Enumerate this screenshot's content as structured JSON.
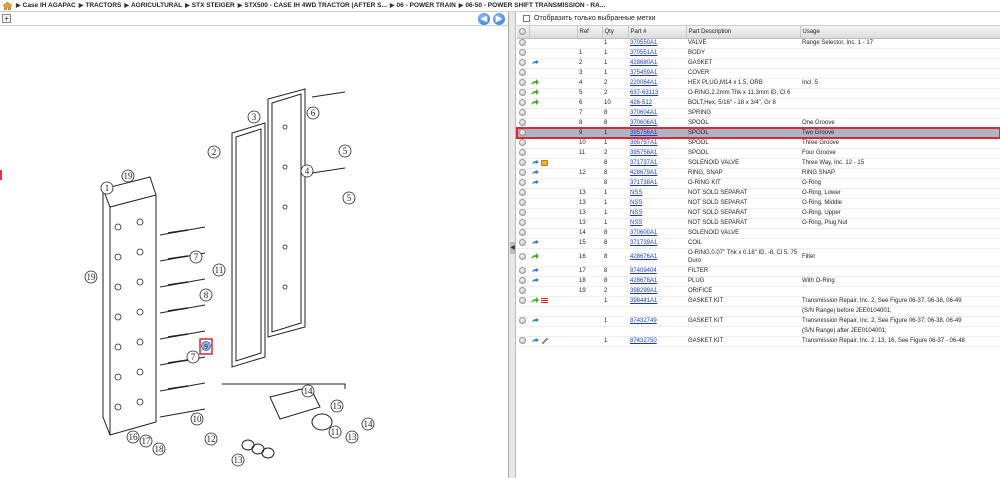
{
  "breadcrumb": [
    "Case IH AGAPAC",
    "TRACTORS",
    "AGRICULTURAL",
    "STX STEIGER",
    "STX500 - CASE IH 4WD TRACTOR (AFTER S...",
    "06 - POWER TRAIN",
    "06-50 - POWER SHIFT TRANSMISSION - RA..."
  ],
  "left_toolbar": {
    "plus": "+",
    "minus": "-",
    "back": "◀",
    "forward": "▶"
  },
  "filter": {
    "label": "Отобразить только выбранные метки"
  },
  "table": {
    "headers": {
      "ref": "Ref",
      "qty": "Qty",
      "part": "Part #",
      "desc": "Part Description",
      "usage": "Usage"
    },
    "rows": [
      {
        "ref": "",
        "qty": "1",
        "part": "370550A1",
        "desc": "VALVE",
        "usage": "Range Selector, Inc. 1 - 17",
        "icons": []
      },
      {
        "ref": "1",
        "qty": "1",
        "part": "370551A1",
        "desc": "BODY",
        "usage": "",
        "icons": []
      },
      {
        "ref": "2",
        "qty": "1",
        "part": "428680A1",
        "desc": "GASKET",
        "usage": "",
        "icons": [
          "blue"
        ]
      },
      {
        "ref": "3",
        "qty": "1",
        "part": "375459A1",
        "desc": "COVER",
        "usage": "",
        "icons": []
      },
      {
        "ref": "4",
        "qty": "2",
        "part": "220064A1",
        "desc": "HEX PLUG,M14 x 1.5, ORB",
        "usage": "Incl. 5",
        "icons": [
          "green"
        ]
      },
      {
        "ref": "5",
        "qty": "2",
        "part": "637-63113",
        "desc": "O-RING,2.2mm Thk x 11.3mm ID, Cl 6",
        "usage": "",
        "icons": [
          "green"
        ]
      },
      {
        "ref": "6",
        "qty": "10",
        "part": "426-512",
        "desc": "BOLT,Hex, 5/16\" - 18 x 3/4\", Gr 8",
        "usage": "",
        "icons": [
          "green"
        ]
      },
      {
        "ref": "7",
        "qty": "8",
        "part": "370604A1",
        "desc": "SPRING",
        "usage": "",
        "icons": []
      },
      {
        "ref": "8",
        "qty": "8",
        "part": "370606A1",
        "desc": "SPOOL",
        "usage": "One Groove",
        "icons": []
      },
      {
        "ref": "9",
        "qty": "1",
        "part": "395756A1",
        "desc": "SPOOL",
        "usage": "Two Groove",
        "icons": [],
        "selected": true
      },
      {
        "ref": "10",
        "qty": "1",
        "part": "395757A1",
        "desc": "SPOOL",
        "usage": "Three Groove",
        "icons": []
      },
      {
        "ref": "11",
        "qty": "2",
        "part": "395758A1",
        "desc": "SPOOL",
        "usage": "Four Groove",
        "icons": []
      },
      {
        "ref": "",
        "qty": "8",
        "part": "371737A1",
        "desc": "SOLENOID VALVE",
        "usage": "Three Way, Inc. 12 - 15",
        "icons": [
          "blue",
          "orange"
        ]
      },
      {
        "ref": "12",
        "qty": "8",
        "part": "428679A1",
        "desc": "RING, SNAP",
        "usage": "RING SNAP",
        "icons": [
          "blue"
        ]
      },
      {
        "ref": "",
        "qty": "8",
        "part": "371738A1",
        "desc": "O-RING KIT",
        "usage": "O-Ring",
        "icons": [
          "blue"
        ]
      },
      {
        "ref": "13",
        "qty": "1",
        "part": "NSS",
        "desc": "NOT SOLD SEPARAT",
        "usage": "O-Ring, Lower",
        "icons": []
      },
      {
        "ref": "13",
        "qty": "1",
        "part": "NSS",
        "desc": "NOT SOLD SEPARAT",
        "usage": "O-Ring, Middle",
        "icons": []
      },
      {
        "ref": "13",
        "qty": "1",
        "part": "NSS",
        "desc": "NOT SOLD SEPARAT",
        "usage": "O-Ring, Upper",
        "icons": []
      },
      {
        "ref": "13",
        "qty": "1",
        "part": "NSS",
        "desc": "NOT SOLD SEPARAT",
        "usage": "O-Ring, Plug Nut",
        "icons": []
      },
      {
        "ref": "14",
        "qty": "8",
        "part": "370600A1",
        "desc": "SOLENOID VALVE",
        "usage": "",
        "icons": []
      },
      {
        "ref": "15",
        "qty": "8",
        "part": "371739A1",
        "desc": "COIL",
        "usage": "",
        "icons": [
          "blue"
        ]
      },
      {
        "ref": "16",
        "qty": "8",
        "part": "428676A1",
        "desc": "O-RING,0.07\" Thk x 0.18\" ID, -8, Cl 5, 75 Duro",
        "usage": "Filter",
        "icons": [
          "green"
        ],
        "tall": true
      },
      {
        "ref": "17",
        "qty": "8",
        "part": "87409404",
        "desc": "FILTER",
        "usage": "",
        "icons": [
          "blue"
        ]
      },
      {
        "ref": "18",
        "qty": "8",
        "part": "428678A1",
        "desc": "PLUG",
        "usage": "With O-Ring",
        "icons": [
          "blue"
        ]
      },
      {
        "ref": "19",
        "qty": "2",
        "part": "398299A1",
        "desc": "ORIFICE",
        "usage": "",
        "icons": []
      },
      {
        "ref": "",
        "qty": "1",
        "part": "398441A1",
        "desc": "GASKET KIT",
        "usage": "Transmission Repair, Inc.  2, See Figure 06-37, 06-38, 06-49",
        "icons": [
          "green",
          "red"
        ]
      },
      {
        "ref": "",
        "qty": "",
        "part": "",
        "desc": "",
        "usage": "(S/N Range) before JEE0104001;",
        "icons": [],
        "noicon": true
      },
      {
        "ref": "",
        "qty": "1",
        "part": "87432749",
        "desc": "GASKET KIT",
        "usage": "Transmission Repair, Inc. 2, See Figure 06-37, 06-38, 06-49",
        "icons": [
          "blue"
        ]
      },
      {
        "ref": "",
        "qty": "",
        "part": "",
        "desc": "",
        "usage": "(S/N Range) after JEE0104001;",
        "icons": [],
        "noicon": true
      },
      {
        "ref": "",
        "qty": "1",
        "part": "87432750",
        "desc": "GASKET KIT",
        "usage": "Transmission Repair, Inc.  2, 13, 16, See Figure 06-37 - 06-48",
        "icons": [
          "blue",
          "wrench"
        ]
      }
    ]
  },
  "diagram": {
    "callouts": [
      "1",
      "2",
      "3",
      "4",
      "5",
      "6",
      "7",
      "8",
      "9",
      "10",
      "11",
      "12",
      "13",
      "14",
      "15",
      "16",
      "17",
      "18",
      "19"
    ],
    "selected_callout": "9"
  },
  "colors": {
    "selected_row": "#aab6c6",
    "highlight_border": "#e0262e",
    "link": "#1a3cc5"
  }
}
